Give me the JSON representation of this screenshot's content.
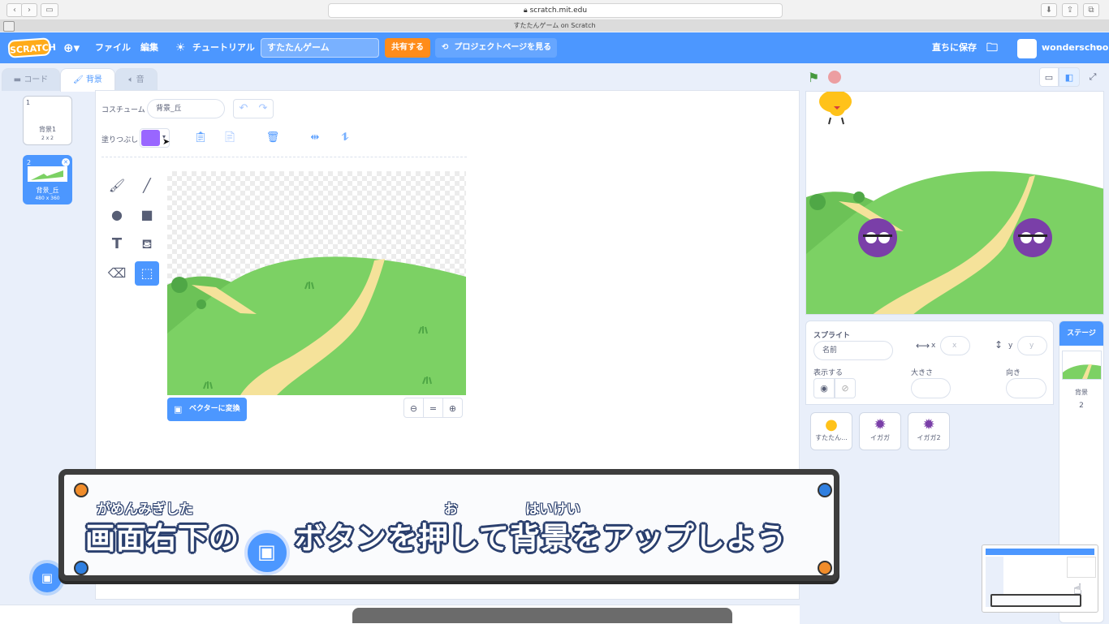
{
  "browser": {
    "url": "scratch.mit.edu",
    "tab_title": "すたたんゲーム on Scratch"
  },
  "menu": {
    "logo": "SCRATCH",
    "language_icon": "globe-icon",
    "file": "ファイル",
    "edit": "編集",
    "tutorial": "チュートリアル",
    "project_title": "すたたんゲーム",
    "share": "共有する",
    "project_page": "プロジェクトページを見る",
    "save_now": "直ちに保存",
    "username": "wonderschool"
  },
  "tabs": {
    "code": "コード",
    "backdrops": "背景",
    "sounds": "音"
  },
  "costumes": [
    {
      "number": "1",
      "name": "背景1",
      "size": "2 x 2"
    },
    {
      "number": "2",
      "name": "背景_丘",
      "size": "480 x 360"
    }
  ],
  "paint_editor": {
    "costume_label": "コスチューム",
    "costume_name": "背景_丘",
    "fill_label": "塗りつぶし",
    "fill_color": "#9966ff",
    "convert_button": "ベクターに変換",
    "zoom_reset": "="
  },
  "sprite_info": {
    "sprite_label": "スプライト",
    "name_placeholder": "名前",
    "x_label": "x",
    "x_placeholder": "x",
    "y_label": "y",
    "y_placeholder": "y",
    "show_label": "表示する",
    "size_label": "大きさ",
    "direction_label": "向き"
  },
  "sprites": [
    {
      "name": "すたたん...",
      "icon": "bulb-character-icon"
    },
    {
      "name": "イガガ",
      "icon": "spiky-purple-icon"
    },
    {
      "name": "イガガ2",
      "icon": "spiky-purple-icon"
    }
  ],
  "stage_pane": {
    "header": "ステージ",
    "backdrop_label": "背景",
    "backdrop_count": "2"
  },
  "subtitle": {
    "text_before": "画面右下の",
    "text_after": "ボタンを押して背景をアップしよう",
    "ruby_gamen_migishita": "がめんみぎした",
    "ruby_o": "お",
    "ruby_haikei": "はいけい"
  },
  "colors": {
    "scratch_blue": "#4c97ff",
    "share_orange": "#ff8c1a",
    "hill_green": "#7cd164",
    "path_tan": "#f5e29a"
  }
}
